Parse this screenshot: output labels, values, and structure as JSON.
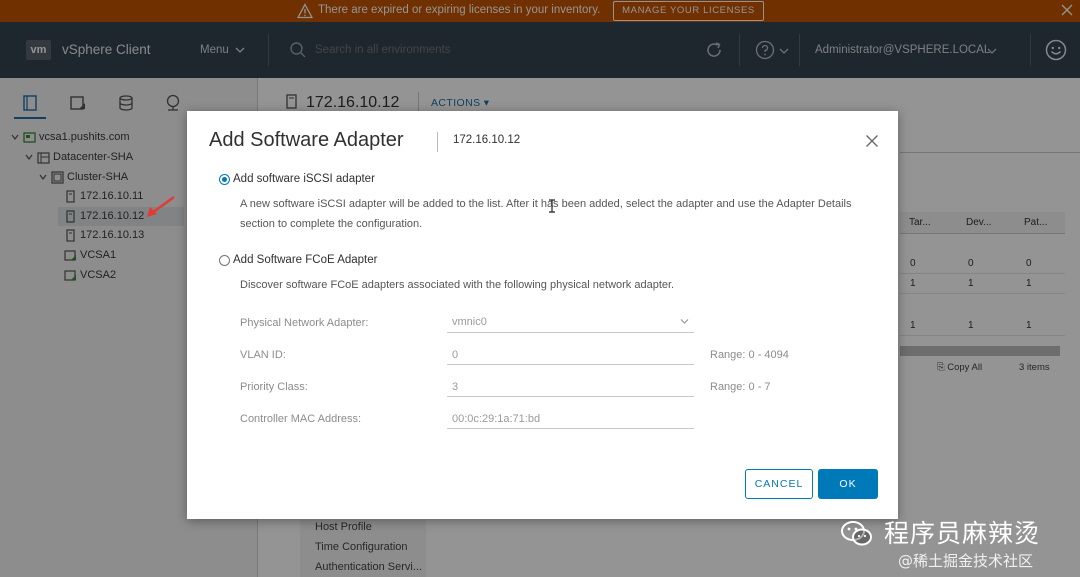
{
  "banner": {
    "message": "There are expired or expiring licenses in your inventory.",
    "button": "MANAGE YOUR LICENSES"
  },
  "header": {
    "logo": "vm",
    "app_name": "vSphere Client",
    "menu": "Menu",
    "search_placeholder": "Search in all environments",
    "user": "Administrator@VSPHERE.LOCAL"
  },
  "tree": {
    "items": [
      {
        "label": "vcsa1.pushits.com"
      },
      {
        "label": "Datacenter-SHA"
      },
      {
        "label": "Cluster-SHA"
      },
      {
        "label": "172.16.10.11"
      },
      {
        "label": "172.16.10.12"
      },
      {
        "label": "172.16.10.13"
      },
      {
        "label": "VCSA1"
      },
      {
        "label": "VCSA2"
      }
    ]
  },
  "main": {
    "host": "172.16.10.12",
    "actions": "ACTIONS",
    "table": {
      "columns": [
        "Tar...",
        "Dev...",
        "Pat..."
      ],
      "rows": [
        [
          "0",
          "0",
          "0"
        ],
        [
          "1",
          "1",
          "1"
        ],
        [
          "1",
          "1",
          "1"
        ]
      ]
    },
    "copy_all": "Copy All",
    "item_count": "3 items",
    "subnav": [
      "Host Profile",
      "Time Configuration",
      "Authentication Servi..."
    ]
  },
  "dialog": {
    "title": "Add Software Adapter",
    "subtitle": "172.16.10.12",
    "option1": {
      "label": "Add software iSCSI adapter",
      "description": "A new software iSCSI adapter will be added to the list. After it has been added, select the adapter and use the Adapter Details section to complete the configuration."
    },
    "option2": {
      "label": "Add Software FCoE Adapter",
      "description": "Discover software FCoE adapters associated with the following physical network adapter."
    },
    "fields": {
      "physical_adapter_label": "Physical Network Adapter:",
      "physical_adapter_value": "vmnic0",
      "vlan_label": "VLAN ID:",
      "vlan_value": "0",
      "vlan_range": "Range: 0 - 4094",
      "priority_label": "Priority Class:",
      "priority_value": "3",
      "priority_range": "Range: 0 - 7",
      "mac_label": "Controller MAC Address:",
      "mac_value": "00:0c:29:1a:71:bd"
    },
    "cancel": "CANCEL",
    "ok": "OK"
  },
  "watermark": {
    "title": "程序员麻辣烫",
    "sub": "@稀土掘金技术社区"
  },
  "colors": {
    "banner": "#c25400",
    "header": "#35444f",
    "primary": "#0079b8",
    "annotation_arrow": "#e53935"
  }
}
